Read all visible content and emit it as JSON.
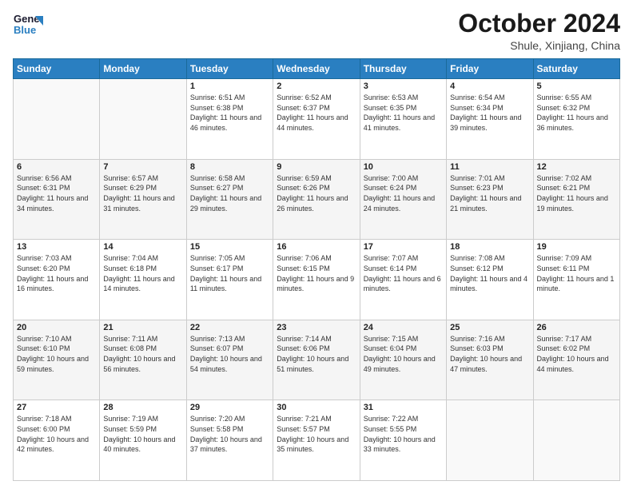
{
  "header": {
    "logo_line1": "General",
    "logo_line2": "Blue",
    "month": "October 2024",
    "location": "Shule, Xinjiang, China"
  },
  "days_of_week": [
    "Sunday",
    "Monday",
    "Tuesday",
    "Wednesday",
    "Thursday",
    "Friday",
    "Saturday"
  ],
  "weeks": [
    [
      {
        "day": "",
        "info": ""
      },
      {
        "day": "",
        "info": ""
      },
      {
        "day": "1",
        "info": "Sunrise: 6:51 AM\nSunset: 6:38 PM\nDaylight: 11 hours and 46 minutes."
      },
      {
        "day": "2",
        "info": "Sunrise: 6:52 AM\nSunset: 6:37 PM\nDaylight: 11 hours and 44 minutes."
      },
      {
        "day": "3",
        "info": "Sunrise: 6:53 AM\nSunset: 6:35 PM\nDaylight: 11 hours and 41 minutes."
      },
      {
        "day": "4",
        "info": "Sunrise: 6:54 AM\nSunset: 6:34 PM\nDaylight: 11 hours and 39 minutes."
      },
      {
        "day": "5",
        "info": "Sunrise: 6:55 AM\nSunset: 6:32 PM\nDaylight: 11 hours and 36 minutes."
      }
    ],
    [
      {
        "day": "6",
        "info": "Sunrise: 6:56 AM\nSunset: 6:31 PM\nDaylight: 11 hours and 34 minutes."
      },
      {
        "day": "7",
        "info": "Sunrise: 6:57 AM\nSunset: 6:29 PM\nDaylight: 11 hours and 31 minutes."
      },
      {
        "day": "8",
        "info": "Sunrise: 6:58 AM\nSunset: 6:27 PM\nDaylight: 11 hours and 29 minutes."
      },
      {
        "day": "9",
        "info": "Sunrise: 6:59 AM\nSunset: 6:26 PM\nDaylight: 11 hours and 26 minutes."
      },
      {
        "day": "10",
        "info": "Sunrise: 7:00 AM\nSunset: 6:24 PM\nDaylight: 11 hours and 24 minutes."
      },
      {
        "day": "11",
        "info": "Sunrise: 7:01 AM\nSunset: 6:23 PM\nDaylight: 11 hours and 21 minutes."
      },
      {
        "day": "12",
        "info": "Sunrise: 7:02 AM\nSunset: 6:21 PM\nDaylight: 11 hours and 19 minutes."
      }
    ],
    [
      {
        "day": "13",
        "info": "Sunrise: 7:03 AM\nSunset: 6:20 PM\nDaylight: 11 hours and 16 minutes."
      },
      {
        "day": "14",
        "info": "Sunrise: 7:04 AM\nSunset: 6:18 PM\nDaylight: 11 hours and 14 minutes."
      },
      {
        "day": "15",
        "info": "Sunrise: 7:05 AM\nSunset: 6:17 PM\nDaylight: 11 hours and 11 minutes."
      },
      {
        "day": "16",
        "info": "Sunrise: 7:06 AM\nSunset: 6:15 PM\nDaylight: 11 hours and 9 minutes."
      },
      {
        "day": "17",
        "info": "Sunrise: 7:07 AM\nSunset: 6:14 PM\nDaylight: 11 hours and 6 minutes."
      },
      {
        "day": "18",
        "info": "Sunrise: 7:08 AM\nSunset: 6:12 PM\nDaylight: 11 hours and 4 minutes."
      },
      {
        "day": "19",
        "info": "Sunrise: 7:09 AM\nSunset: 6:11 PM\nDaylight: 11 hours and 1 minute."
      }
    ],
    [
      {
        "day": "20",
        "info": "Sunrise: 7:10 AM\nSunset: 6:10 PM\nDaylight: 10 hours and 59 minutes."
      },
      {
        "day": "21",
        "info": "Sunrise: 7:11 AM\nSunset: 6:08 PM\nDaylight: 10 hours and 56 minutes."
      },
      {
        "day": "22",
        "info": "Sunrise: 7:13 AM\nSunset: 6:07 PM\nDaylight: 10 hours and 54 minutes."
      },
      {
        "day": "23",
        "info": "Sunrise: 7:14 AM\nSunset: 6:06 PM\nDaylight: 10 hours and 51 minutes."
      },
      {
        "day": "24",
        "info": "Sunrise: 7:15 AM\nSunset: 6:04 PM\nDaylight: 10 hours and 49 minutes."
      },
      {
        "day": "25",
        "info": "Sunrise: 7:16 AM\nSunset: 6:03 PM\nDaylight: 10 hours and 47 minutes."
      },
      {
        "day": "26",
        "info": "Sunrise: 7:17 AM\nSunset: 6:02 PM\nDaylight: 10 hours and 44 minutes."
      }
    ],
    [
      {
        "day": "27",
        "info": "Sunrise: 7:18 AM\nSunset: 6:00 PM\nDaylight: 10 hours and 42 minutes."
      },
      {
        "day": "28",
        "info": "Sunrise: 7:19 AM\nSunset: 5:59 PM\nDaylight: 10 hours and 40 minutes."
      },
      {
        "day": "29",
        "info": "Sunrise: 7:20 AM\nSunset: 5:58 PM\nDaylight: 10 hours and 37 minutes."
      },
      {
        "day": "30",
        "info": "Sunrise: 7:21 AM\nSunset: 5:57 PM\nDaylight: 10 hours and 35 minutes."
      },
      {
        "day": "31",
        "info": "Sunrise: 7:22 AM\nSunset: 5:55 PM\nDaylight: 10 hours and 33 minutes."
      },
      {
        "day": "",
        "info": ""
      },
      {
        "day": "",
        "info": ""
      }
    ]
  ]
}
